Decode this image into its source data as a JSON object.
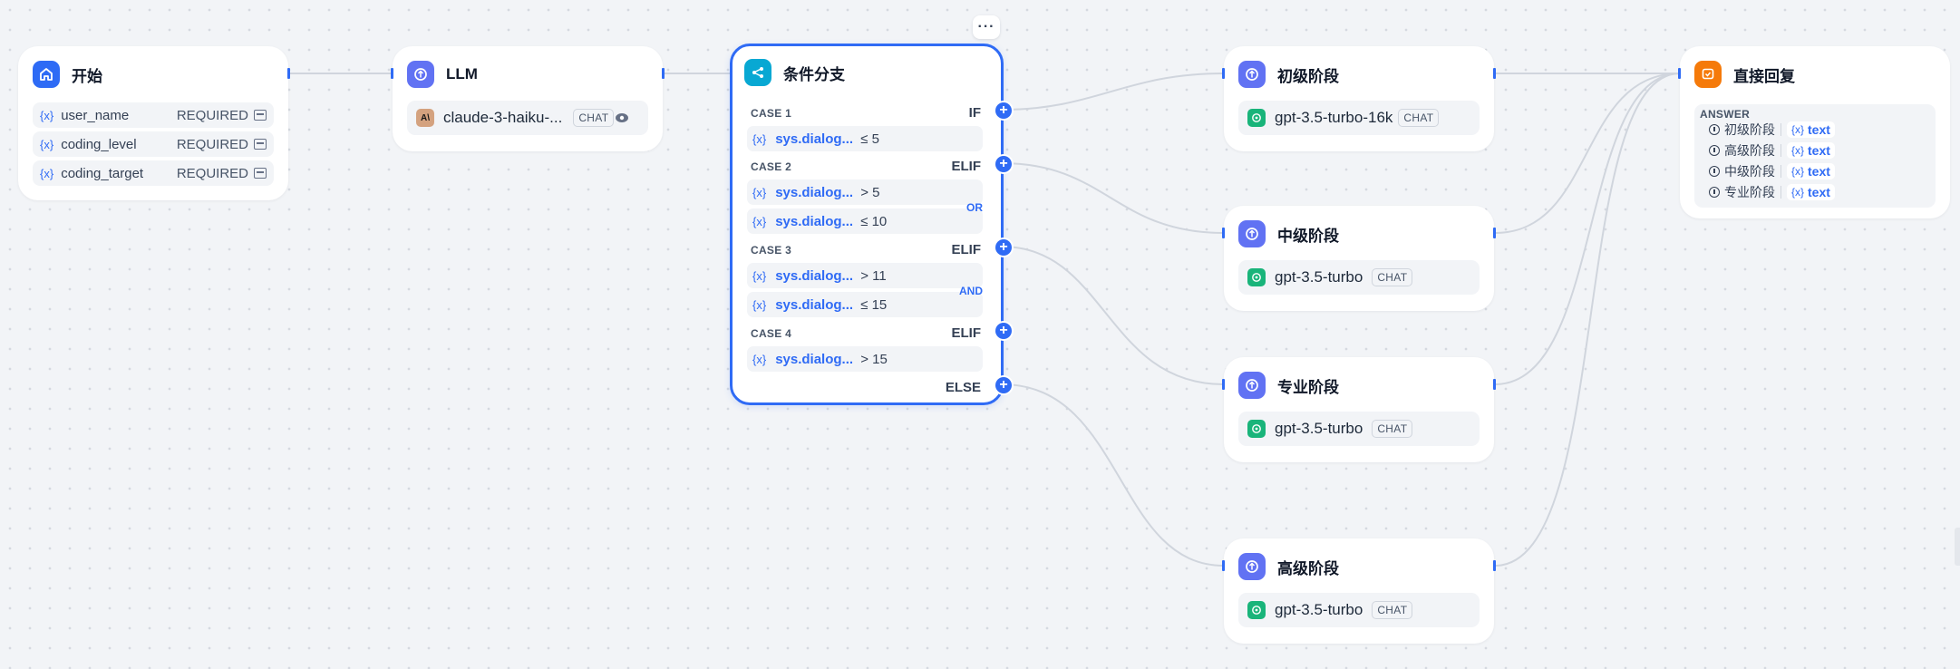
{
  "nodes": {
    "start": {
      "title": "开始",
      "variables": [
        {
          "name": "user_name",
          "status": "REQUIRED"
        },
        {
          "name": "coding_level",
          "status": "REQUIRED"
        },
        {
          "name": "coding_target",
          "status": "REQUIRED"
        }
      ]
    },
    "llm": {
      "title": "LLM",
      "model": "claude-3-haiku-...",
      "mode": "CHAT"
    },
    "condition": {
      "title": "条件分支",
      "more": "···",
      "cases": [
        {
          "label": "CASE 1",
          "keyword": "IF",
          "conditions": [
            {
              "var": "sys.dialog...",
              "op": "≤ 5"
            }
          ]
        },
        {
          "label": "CASE 2",
          "keyword": "ELIF",
          "logic": "OR",
          "conditions": [
            {
              "var": "sys.dialog...",
              "op": "> 5"
            },
            {
              "var": "sys.dialog...",
              "op": "≤ 10"
            }
          ]
        },
        {
          "label": "CASE 3",
          "keyword": "ELIF",
          "logic": "AND",
          "conditions": [
            {
              "var": "sys.dialog...",
              "op": "> 11"
            },
            {
              "var": "sys.dialog...",
              "op": "≤ 15"
            }
          ]
        },
        {
          "label": "CASE 4",
          "keyword": "ELIF",
          "conditions": [
            {
              "var": "sys.dialog...",
              "op": "> 15"
            }
          ]
        }
      ],
      "else": "ELSE"
    },
    "stage_beginner": {
      "title": "初级阶段",
      "model": "gpt-3.5-turbo-16k",
      "mode": "CHAT"
    },
    "stage_intermediate": {
      "title": "中级阶段",
      "model": "gpt-3.5-turbo",
      "mode": "CHAT"
    },
    "stage_professional": {
      "title": "专业阶段",
      "model": "gpt-3.5-turbo",
      "mode": "CHAT"
    },
    "stage_advanced": {
      "title": "高级阶段",
      "model": "gpt-3.5-turbo",
      "mode": "CHAT"
    },
    "answer": {
      "title": "直接回复",
      "label": "ANSWER",
      "lines": [
        {
          "node": "初级阶段",
          "var": "text"
        },
        {
          "node": "高级阶段",
          "var": "text"
        },
        {
          "node": "中级阶段",
          "var": "text"
        },
        {
          "node": "专业阶段",
          "var": "text"
        }
      ]
    }
  },
  "symbols": {
    "variable": "{x}",
    "plus": "+"
  },
  "colors": {
    "accent": "#2f6bf5",
    "start_icon": "#2e6bf5",
    "llm_icon": "#6172f3",
    "condition_icon": "#08a8d3",
    "answer_icon": "#f57a0a",
    "openai_logo": "#19b47a",
    "anthropic_logo": "#d4a27f",
    "edge": "#d0d5dd"
  },
  "icons": {
    "start": "home-icon",
    "llm": "llm-icon",
    "condition": "branch-icon",
    "answer": "reply-icon",
    "openai": "openai-logo-icon",
    "anthropic": "anthropic-logo-icon",
    "vision": "eye-icon",
    "required": "input-field-icon"
  }
}
